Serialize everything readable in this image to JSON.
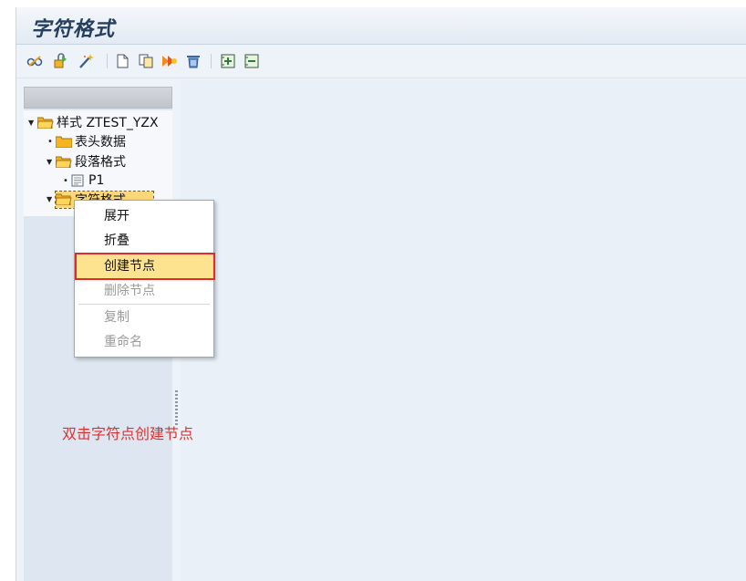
{
  "window": {
    "title": "字符格式"
  },
  "toolbar": {
    "icons": [
      "glasses-icon",
      "display-change-icon",
      "magic-wand-icon",
      "new-document-icon",
      "copy-icon",
      "transport-icon",
      "delete-icon",
      "expand-all-icon",
      "collapse-all-icon"
    ]
  },
  "tree": {
    "root_label": "样式 ZTEST_YZX",
    "header_data_label": "表头数据",
    "paragraph_formats_label": "段落格式",
    "p1_label": "P1",
    "character_formats_label": "字符格式"
  },
  "context_menu": {
    "expand": "展开",
    "collapse": "折叠",
    "create_node": "创建节点",
    "delete_node": "删除节点",
    "copy": "复制",
    "rename": "重命名"
  },
  "annotation": {
    "text": "双击字符点创建节点",
    "color": "#e0302e"
  },
  "colors": {
    "selected": "#fbd77a",
    "highlight_border": "#e02b2b",
    "pane": "#e9f0f8"
  }
}
